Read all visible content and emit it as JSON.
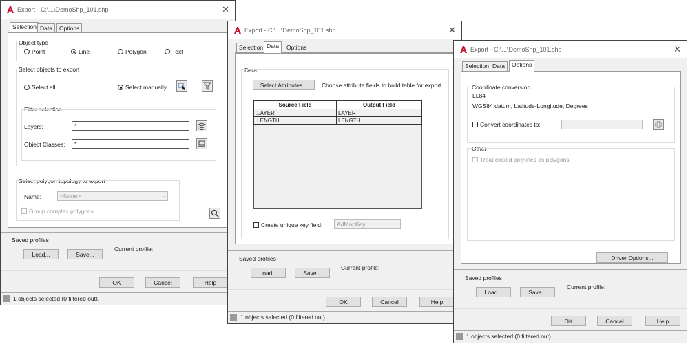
{
  "app": {
    "window_title": "Export - C:\\...\\DemoShp_101.shp",
    "close_glyph": "✕",
    "accent_color": "#c8102e"
  },
  "tabs": [
    "Selection",
    "Data",
    "Options"
  ],
  "dialog1": {
    "object_type": {
      "heading": "Object type",
      "options": [
        "Point",
        "Line",
        "Polygon",
        "Text"
      ],
      "selected": "Line"
    },
    "select_objects": {
      "heading": "Select objects to export",
      "select_all": "Select all",
      "select_manually": "Select manually",
      "selected": "Select manually"
    },
    "filter": {
      "heading": "Filter selection",
      "layers_label": "Layers:",
      "layers_value": "*",
      "classes_label": "Object Classes:",
      "classes_value": "*"
    },
    "topology": {
      "heading": "Select polygon topology to export",
      "name_label": "Name:",
      "name_value": "<None>",
      "group_label": "Group complex polygons"
    }
  },
  "dialog2": {
    "data_heading": "Data",
    "select_attributes_button": "Select Attributes...",
    "hint": "Choose attribute fields to build table for export",
    "columns": [
      "Source Field",
      "Output Field"
    ],
    "rows": [
      [
        ".LAYER",
        "LAYER"
      ],
      [
        ".LENGTH",
        "LENGTH"
      ]
    ],
    "unique_key_label": "Create unique key field:",
    "unique_key_value": "AdMapKey"
  },
  "dialog3": {
    "coord_heading": "Coordinate conversion",
    "coord_code": "LL84",
    "coord_desc": "WGS84 datum, Latitude-Longitude; Degrees",
    "convert_label": "Convert coordinates to:",
    "other_heading": "Other",
    "closed_polylines_label": "Treat closed polylines as polygons",
    "driver_options_button": "Driver Options..."
  },
  "common": {
    "saved_profiles": "Saved profiles",
    "current_profile": "Current profile:",
    "load": "Load...",
    "save": "Save...",
    "ok": "OK",
    "cancel": "Cancel",
    "help": "Help",
    "status": "1 objects selected (0 filtered out)."
  }
}
